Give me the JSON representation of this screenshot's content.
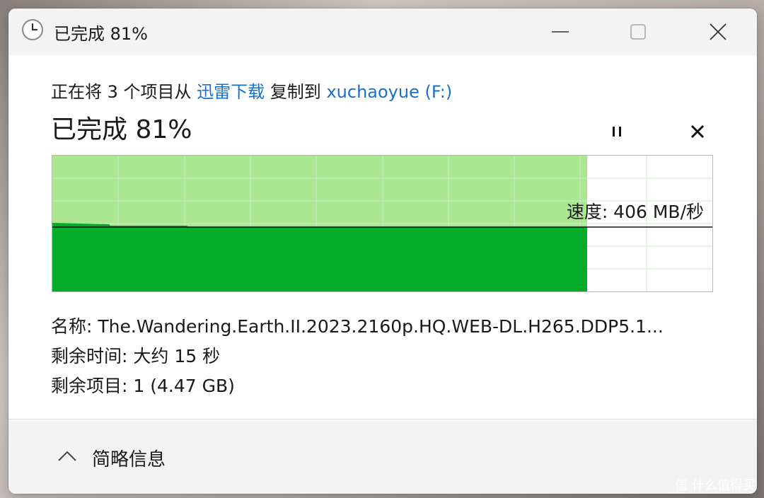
{
  "window": {
    "title": "已完成 81%"
  },
  "copy": {
    "prefix": "正在将 3 个项目从",
    "source": "迅雷下载",
    "middle": "复制到",
    "destination": "xuchaoyue (F:)"
  },
  "status": {
    "big_text": "已完成 81%",
    "progress_percent": 81
  },
  "graph": {
    "speed_label": "速度: 406 MB/秒"
  },
  "details": {
    "name_label": "名称:",
    "name_value": "The.Wandering.Earth.II.2023.2160p.HQ.WEB-DL.H265.DDP5.1...",
    "time_label": "剩余时间:",
    "time_value": "大约 15 秒",
    "items_label": "剩余项目:",
    "items_value": "1 (4.47 GB)"
  },
  "footer": {
    "toggle_label": "简略信息"
  },
  "watermark": "值 什么值得买",
  "colors": {
    "fill_dark": "#05ac29",
    "fill_light": "#abe690",
    "grid": "#cfe9c8",
    "link": "#1a6fce"
  },
  "icons": {
    "title": "clock-icon",
    "minimize": "minimize-icon",
    "maximize": "maximize-icon",
    "close": "close-icon",
    "pause": "pause-icon",
    "cancel": "cancel-icon",
    "toggle": "chevron-up-icon"
  }
}
